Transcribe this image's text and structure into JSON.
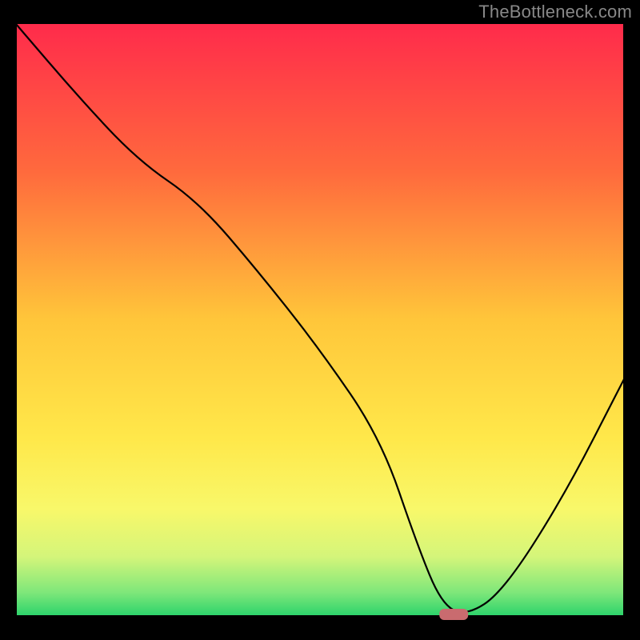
{
  "watermark": "TheBottleneck.com",
  "chart_data": {
    "type": "line",
    "title": "",
    "xlabel": "",
    "ylabel": "",
    "xlim": [
      0,
      100
    ],
    "ylim": [
      0,
      100
    ],
    "x": [
      0,
      10,
      20,
      30,
      40,
      50,
      60,
      66,
      70,
      74,
      80,
      90,
      100
    ],
    "values": [
      100,
      88,
      77,
      70,
      58,
      45,
      30,
      12,
      2,
      0,
      4,
      20,
      40
    ],
    "marker": {
      "x": 72,
      "y": 0,
      "color": "#c96b6f"
    },
    "gradient_stops": [
      {
        "offset": 0.0,
        "color": "#ff2b4b"
      },
      {
        "offset": 0.25,
        "color": "#ff6a3d"
      },
      {
        "offset": 0.5,
        "color": "#ffc63a"
      },
      {
        "offset": 0.7,
        "color": "#ffe84a"
      },
      {
        "offset": 0.82,
        "color": "#f8f86a"
      },
      {
        "offset": 0.9,
        "color": "#d4f57a"
      },
      {
        "offset": 0.96,
        "color": "#7fe77a"
      },
      {
        "offset": 1.0,
        "color": "#2bd36b"
      }
    ]
  }
}
